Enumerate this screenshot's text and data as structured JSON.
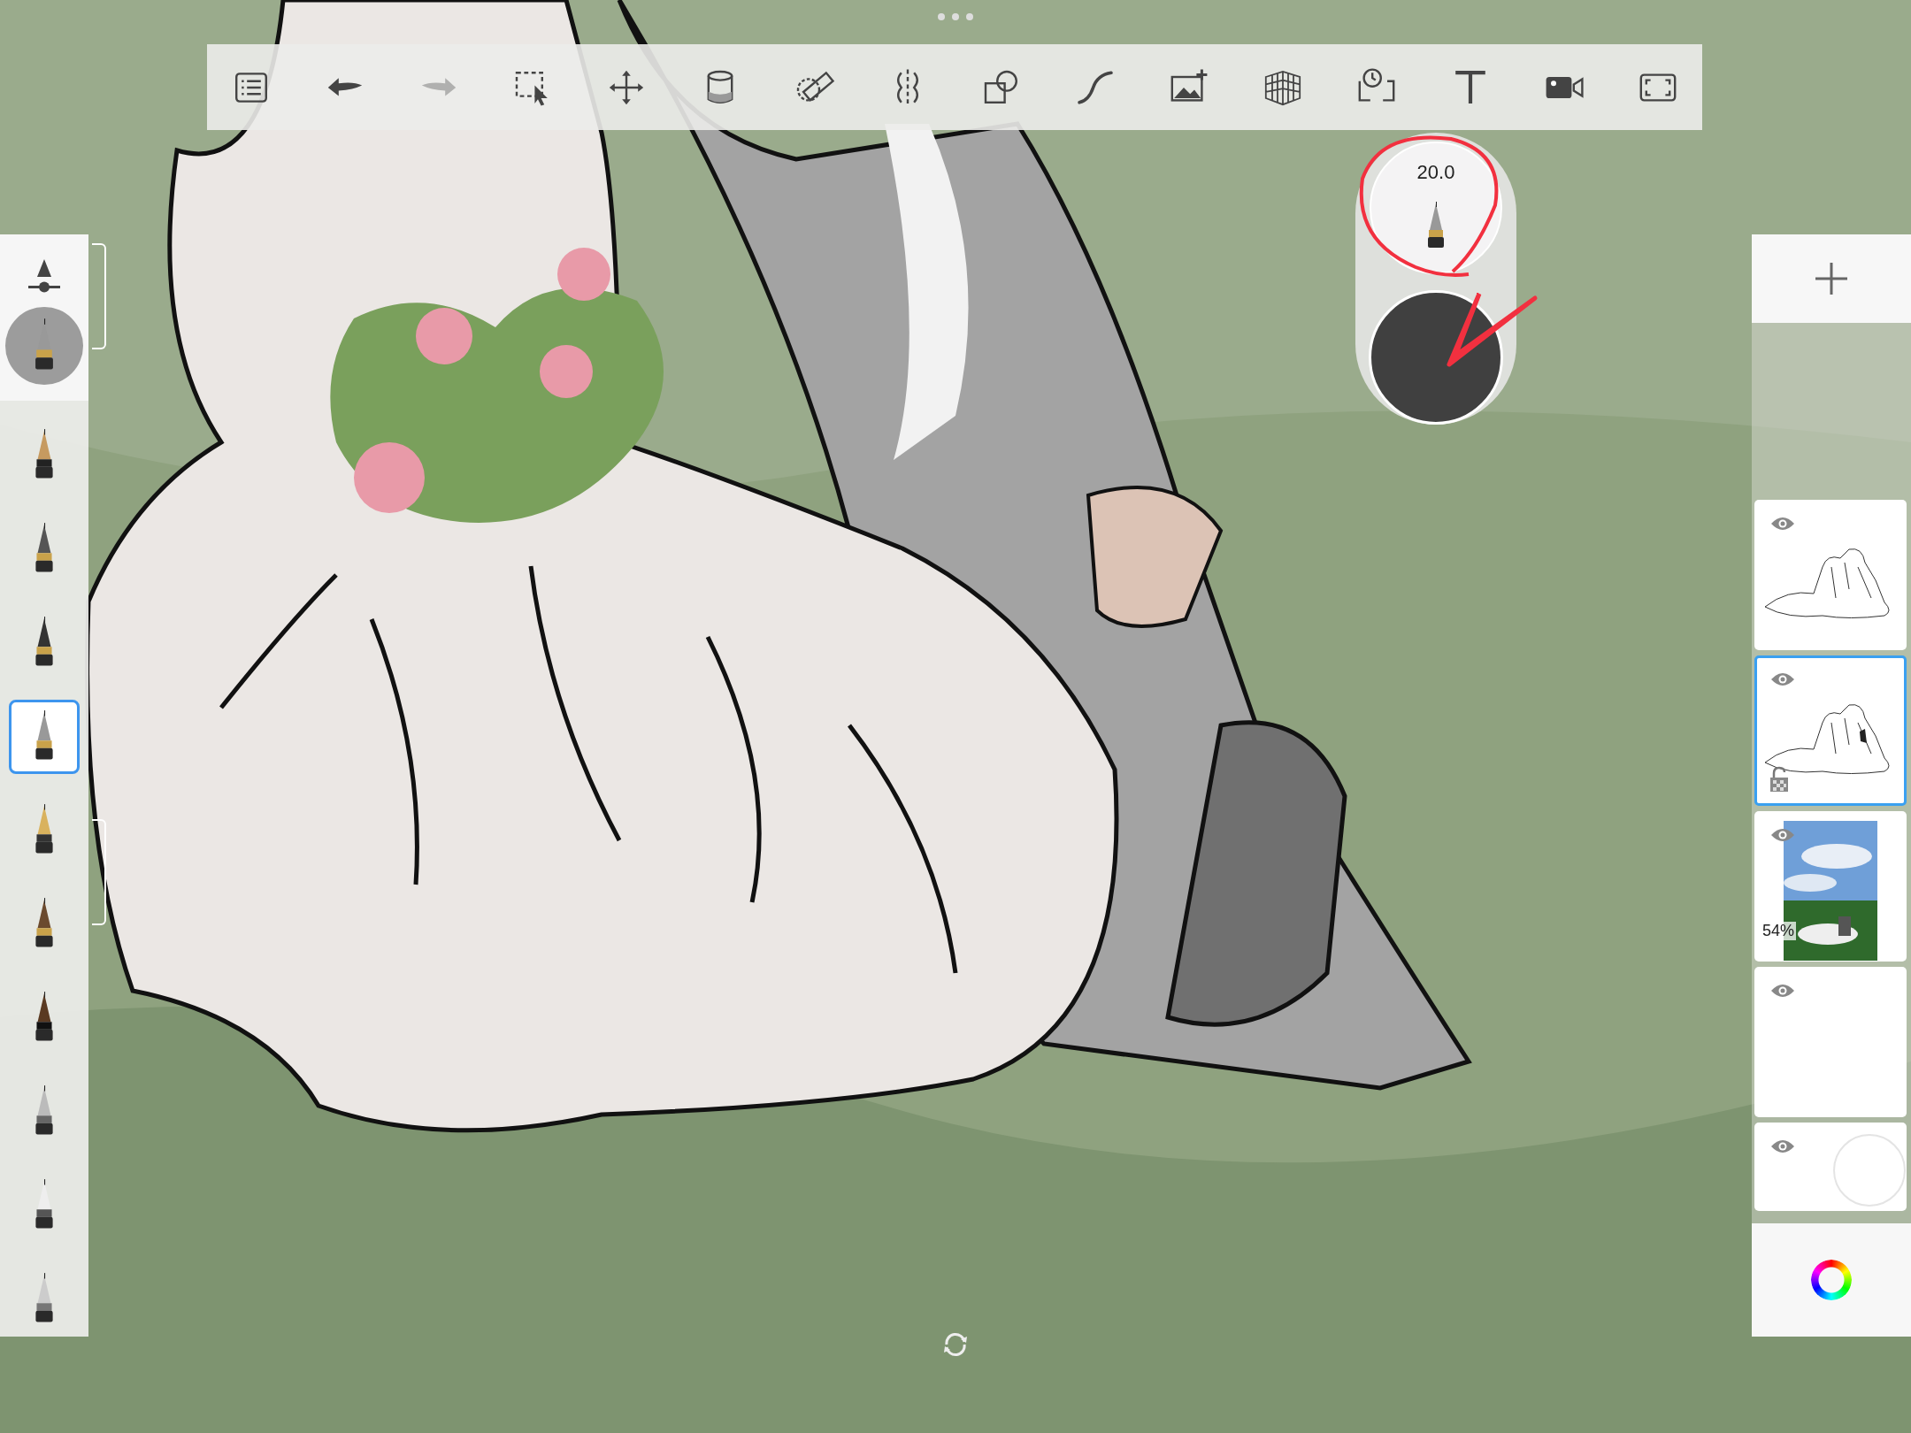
{
  "toolbar": {
    "tools": [
      {
        "kind": "menu",
        "disabled": false
      },
      {
        "kind": "undo",
        "disabled": false
      },
      {
        "kind": "redo",
        "disabled": true
      },
      {
        "kind": "select",
        "disabled": false
      },
      {
        "kind": "transform",
        "disabled": false
      },
      {
        "kind": "fill",
        "disabled": false
      },
      {
        "kind": "ruler",
        "disabled": false
      },
      {
        "kind": "symmetry",
        "disabled": false
      },
      {
        "kind": "shapes",
        "disabled": false
      },
      {
        "kind": "stroke",
        "disabled": false
      },
      {
        "kind": "add-image",
        "disabled": false
      },
      {
        "kind": "perspective",
        "disabled": false
      },
      {
        "kind": "timelapse",
        "disabled": false
      },
      {
        "kind": "text",
        "disabled": false
      },
      {
        "kind": "video",
        "disabled": false
      },
      {
        "kind": "fullscreen",
        "disabled": false
      }
    ]
  },
  "brushes": [
    {
      "kind": "pencil",
      "selected": false
    },
    {
      "kind": "marker",
      "selected": false
    },
    {
      "kind": "technical",
      "selected": false
    },
    {
      "kind": "ballpoint",
      "selected": true
    },
    {
      "kind": "fountain",
      "selected": false
    },
    {
      "kind": "brush",
      "selected": false
    },
    {
      "kind": "ink",
      "selected": false
    },
    {
      "kind": "airbrush",
      "selected": false
    },
    {
      "kind": "eraser",
      "selected": false
    },
    {
      "kind": "chisel",
      "selected": false
    }
  ],
  "brush_puck": {
    "size": "20.0"
  },
  "layers": [
    {
      "kind": "drawing",
      "visible": true,
      "selected": false,
      "lock_badge": false
    },
    {
      "kind": "drawing",
      "visible": true,
      "selected": true,
      "lock_badge": true
    },
    {
      "visible": true,
      "selected": false,
      "lock_badge": false,
      "opacity": "54%"
    },
    {
      "kind": "empty",
      "visible": true,
      "selected": false,
      "lock_badge": false
    },
    {
      "kind": "background",
      "visible": true,
      "selected": false,
      "lock_badge": false
    }
  ]
}
